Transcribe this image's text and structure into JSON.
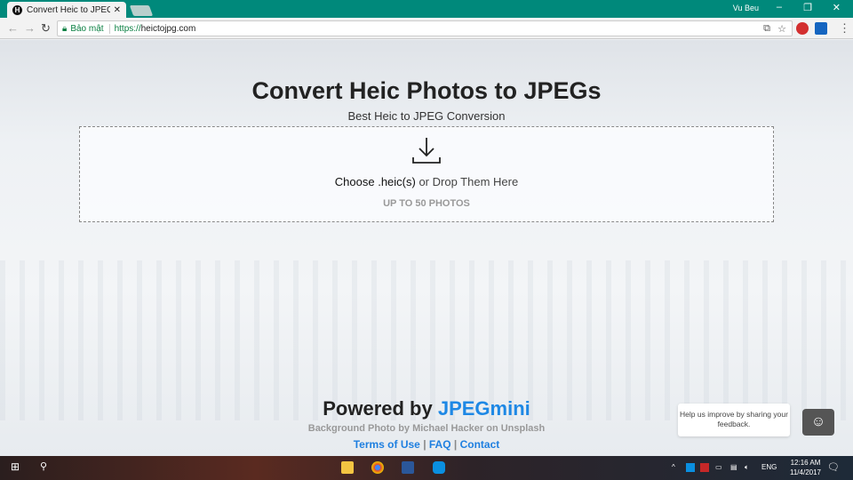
{
  "browser": {
    "tab_title": "Convert Heic to JPEG for",
    "favicon_letter": "H",
    "user": "Vu Beu",
    "secure_label": "Bảo mật",
    "url_protocol": "https://",
    "url_host": "heictojpg.com",
    "accent": "#00897b"
  },
  "main": {
    "title": "Convert Heic Photos to JPEGs",
    "subtitle": "Best Heic to JPEG Conversion",
    "choose_label": "Choose .heic(s)",
    "drop_label": " or Drop Them Here",
    "limit": "UP TO 50 PHOTOS"
  },
  "footer": {
    "powered_prefix": "Powered by ",
    "powered_brand": "JPEGmini",
    "credit": "Background Photo by Michael Hacker on Unsplash",
    "links": [
      "Terms of Use",
      "FAQ",
      "Contact"
    ],
    "separator": " | ",
    "link_color": "#1e7fe0"
  },
  "feedback": {
    "text": "Help us improve by sharing your feedback."
  },
  "taskbar": {
    "lang": "ENG",
    "time": "12:16 AM",
    "date": "11/4/2017"
  }
}
